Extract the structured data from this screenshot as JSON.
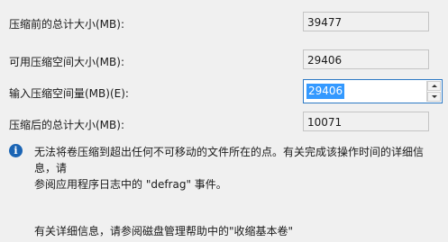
{
  "rows": {
    "total_before": {
      "label": "压缩前的总计大小(MB):",
      "value": "39477"
    },
    "available": {
      "label": "可用压缩空间大小(MB):",
      "value": "29406"
    },
    "shrink_amount": {
      "label": "输入压缩空间量(MB)(E):",
      "value": "29406"
    },
    "total_after": {
      "label": "压缩后的总计大小(MB):",
      "value": "10071"
    }
  },
  "info": {
    "icon": "info-icon",
    "glyph": "i",
    "line1": "无法将卷压缩到超出任何不可移动的文件所在的点。有关完成该操作时间的详细信息，请",
    "line2": "参阅应用程序日志中的 \"defrag\" 事件。"
  },
  "footer": {
    "text": "有关详细信息，请参阅磁盘管理帮助中的\"收缩基本卷\""
  },
  "colors": {
    "selection": "#3399ff",
    "focus_border": "#2b78c5",
    "info_icon": "#1a64b4"
  }
}
